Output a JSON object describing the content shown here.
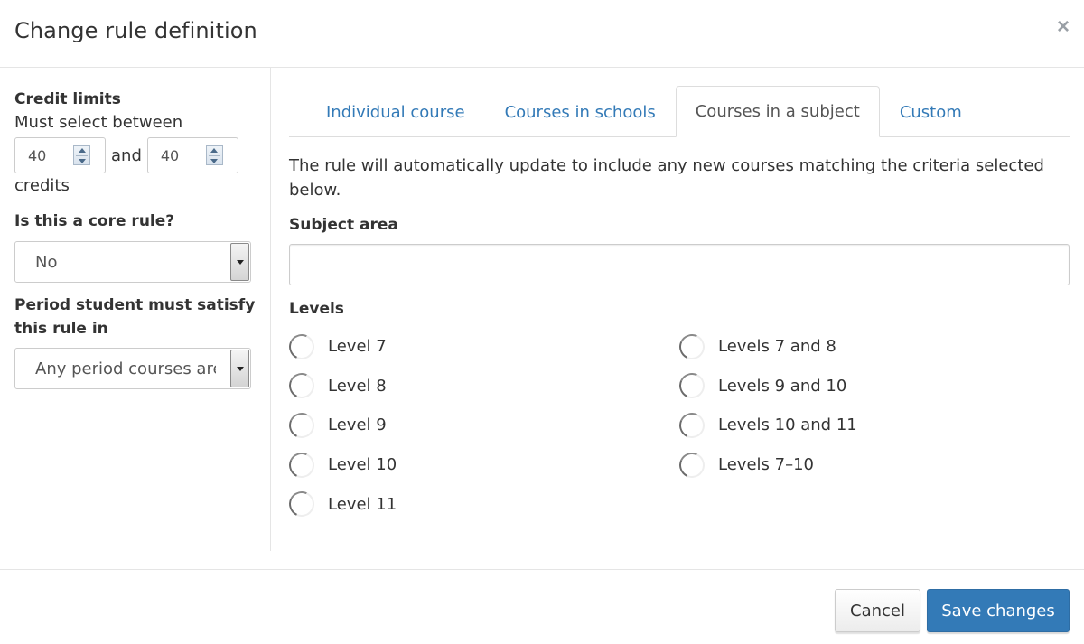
{
  "dialog": {
    "title": "Change rule definition",
    "close_icon": "close-icon"
  },
  "left": {
    "credit_limits_label": "Credit limits",
    "must_select_text": "Must select between",
    "min_credits": "40",
    "and_text": "and",
    "max_credits": "40",
    "credits_text": "credits",
    "core_rule_label": "Is this a core rule?",
    "core_rule_value": "No",
    "period_label_line1": "Period student must satisfy",
    "period_label_line2": "this rule in",
    "period_value": "Any period courses are"
  },
  "tabs": [
    {
      "label": "Individual course",
      "active": false
    },
    {
      "label": "Courses in schools",
      "active": false
    },
    {
      "label": "Courses in a subject",
      "active": true
    },
    {
      "label": "Custom",
      "active": false
    }
  ],
  "panel": {
    "description": "The rule will automatically update to include any new courses matching the criteria selected below.",
    "subject_area_label": "Subject area",
    "subject_area_value": "",
    "levels_label": "Levels",
    "levels_left": [
      "Level 7",
      "Level 8",
      "Level 9",
      "Level 10",
      "Level 11"
    ],
    "levels_right": [
      "Levels 7 and 8",
      "Levels 9 and 10",
      "Levels 10 and 11",
      "Levels 7–10"
    ]
  },
  "footer": {
    "cancel_label": "Cancel",
    "save_label": "Save changes"
  },
  "colors": {
    "primary": "#337ab7",
    "tab_link": "#337ab7",
    "border": "#e5e5e5"
  }
}
